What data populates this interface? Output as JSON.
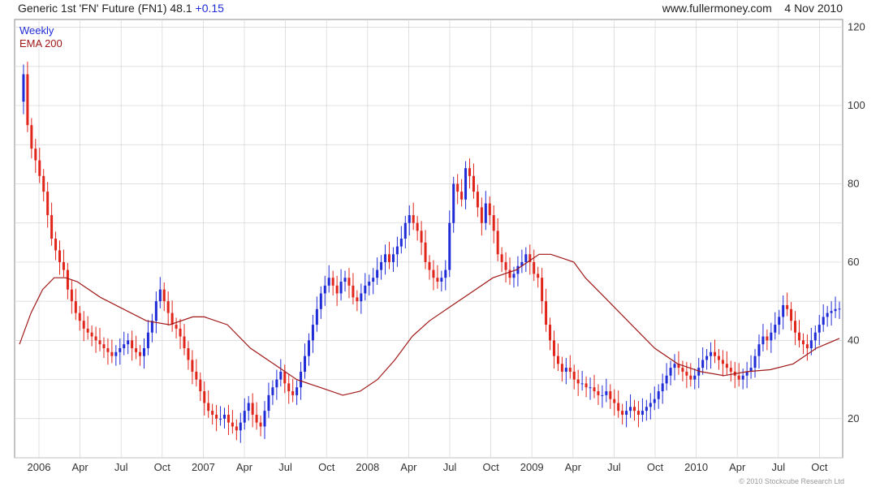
{
  "header": {
    "instrument": "Generic 1st 'FN' Future (FN1)",
    "last": "48.1",
    "change": "+0.15",
    "site": "www.fullermoney.com",
    "date": "4 Nov 2010"
  },
  "legend": {
    "series1": "Weekly",
    "series2": "EMA 200"
  },
  "copyright": "© 2010 Stockcube Research Ltd",
  "colors": {
    "up": "#1f2bd6",
    "down": "#e1251b",
    "ema": "#a01818",
    "grid": "#d4d4d4",
    "axis": "#777777"
  },
  "chart_data": {
    "type": "candlestick",
    "x_ticks": [
      "2006",
      "Apr",
      "Jul",
      "Oct",
      "2007",
      "Apr",
      "Jul",
      "Oct",
      "2008",
      "Apr",
      "Jul",
      "Oct",
      "2009",
      "Apr",
      "Jul",
      "Oct",
      "2010",
      "Apr",
      "Jul",
      "Oct"
    ],
    "y_ticks": [
      20,
      40,
      60,
      80,
      100,
      120
    ],
    "ylim": [
      10,
      122
    ],
    "grid": true,
    "weekly_close_points": [
      [
        0,
        101
      ],
      [
        1,
        108
      ],
      [
        2,
        95
      ],
      [
        3,
        89
      ],
      [
        4,
        86
      ],
      [
        5,
        82
      ],
      [
        6,
        78
      ],
      [
        7,
        72
      ],
      [
        8,
        66
      ],
      [
        9,
        63
      ],
      [
        10,
        60
      ],
      [
        11,
        58
      ],
      [
        12,
        53
      ],
      [
        13,
        50
      ],
      [
        14,
        47
      ],
      [
        15,
        45
      ],
      [
        16,
        43
      ],
      [
        17,
        42
      ],
      [
        18,
        41
      ],
      [
        19,
        40
      ],
      [
        20,
        39
      ],
      [
        21,
        38
      ],
      [
        22,
        37
      ],
      [
        23,
        36
      ],
      [
        24,
        37
      ],
      [
        25,
        38
      ],
      [
        26,
        39
      ],
      [
        27,
        40
      ],
      [
        28,
        38
      ],
      [
        29,
        37
      ],
      [
        30,
        36
      ],
      [
        31,
        38
      ],
      [
        32,
        42
      ],
      [
        33,
        45
      ],
      [
        34,
        50
      ],
      [
        35,
        53
      ],
      [
        36,
        50
      ],
      [
        37,
        47
      ],
      [
        38,
        44
      ],
      [
        39,
        43
      ],
      [
        40,
        41
      ],
      [
        41,
        38
      ],
      [
        42,
        35
      ],
      [
        43,
        32
      ],
      [
        44,
        30
      ],
      [
        45,
        27
      ],
      [
        46,
        24
      ],
      [
        47,
        22
      ],
      [
        48,
        21
      ],
      [
        49,
        20
      ],
      [
        50,
        20
      ],
      [
        51,
        21
      ],
      [
        52,
        19
      ],
      [
        53,
        18
      ],
      [
        54,
        17
      ],
      [
        55,
        19
      ],
      [
        56,
        22
      ],
      [
        57,
        24
      ],
      [
        58,
        21
      ],
      [
        59,
        19
      ],
      [
        60,
        18
      ],
      [
        61,
        22
      ],
      [
        62,
        26
      ],
      [
        63,
        28
      ],
      [
        64,
        30
      ],
      [
        65,
        32
      ],
      [
        66,
        29
      ],
      [
        67,
        27
      ],
      [
        68,
        26
      ],
      [
        69,
        28
      ],
      [
        70,
        32
      ],
      [
        71,
        36
      ],
      [
        72,
        40
      ],
      [
        73,
        44
      ],
      [
        74,
        48
      ],
      [
        75,
        52
      ],
      [
        76,
        54
      ],
      [
        77,
        56
      ],
      [
        78,
        54
      ],
      [
        79,
        52
      ],
      [
        80,
        55
      ],
      [
        81,
        56
      ],
      [
        82,
        54
      ],
      [
        83,
        51
      ],
      [
        84,
        50
      ],
      [
        85,
        52
      ],
      [
        86,
        54
      ],
      [
        87,
        55
      ],
      [
        88,
        56
      ],
      [
        89,
        58
      ],
      [
        90,
        60
      ],
      [
        91,
        62
      ],
      [
        92,
        60
      ],
      [
        93,
        62
      ],
      [
        94,
        64
      ],
      [
        95,
        66
      ],
      [
        96,
        70
      ],
      [
        97,
        72
      ],
      [
        98,
        70
      ],
      [
        99,
        68
      ],
      [
        100,
        65
      ],
      [
        101,
        60
      ],
      [
        102,
        58
      ],
      [
        103,
        56
      ],
      [
        104,
        55
      ],
      [
        105,
        56
      ],
      [
        106,
        58
      ],
      [
        107,
        70
      ],
      [
        108,
        80
      ],
      [
        109,
        78
      ],
      [
        110,
        76
      ],
      [
        111,
        84
      ],
      [
        112,
        82
      ],
      [
        113,
        78
      ],
      [
        114,
        74
      ],
      [
        115,
        70
      ],
      [
        116,
        75
      ],
      [
        117,
        72
      ],
      [
        118,
        68
      ],
      [
        119,
        62
      ],
      [
        120,
        60
      ],
      [
        121,
        58
      ],
      [
        122,
        56
      ],
      [
        123,
        57
      ],
      [
        124,
        59
      ],
      [
        125,
        60
      ],
      [
        126,
        62
      ],
      [
        127,
        60
      ],
      [
        128,
        57
      ],
      [
        129,
        56
      ],
      [
        130,
        50
      ],
      [
        131,
        44
      ],
      [
        132,
        40
      ],
      [
        133,
        36
      ],
      [
        134,
        34
      ],
      [
        135,
        32
      ],
      [
        136,
        33
      ],
      [
        137,
        32
      ],
      [
        138,
        30
      ],
      [
        139,
        29
      ],
      [
        140,
        29
      ],
      [
        141,
        28
      ],
      [
        142,
        28
      ],
      [
        143,
        27
      ],
      [
        144,
        26
      ],
      [
        145,
        26
      ],
      [
        146,
        27
      ],
      [
        147,
        25
      ],
      [
        148,
        24
      ],
      [
        149,
        22
      ],
      [
        150,
        21
      ],
      [
        151,
        22
      ],
      [
        152,
        23
      ],
      [
        153,
        22
      ],
      [
        154,
        21
      ],
      [
        155,
        22
      ],
      [
        156,
        23
      ],
      [
        157,
        24
      ],
      [
        158,
        25
      ],
      [
        159,
        27
      ],
      [
        160,
        29
      ],
      [
        161,
        31
      ],
      [
        162,
        33
      ],
      [
        163,
        34
      ],
      [
        164,
        33
      ],
      [
        165,
        32
      ],
      [
        166,
        31
      ],
      [
        167,
        30
      ],
      [
        168,
        31
      ],
      [
        169,
        33
      ],
      [
        170,
        35
      ],
      [
        171,
        36
      ],
      [
        172,
        37
      ],
      [
        173,
        36
      ],
      [
        174,
        35
      ],
      [
        175,
        34
      ],
      [
        176,
        33
      ],
      [
        177,
        32
      ],
      [
        178,
        31
      ],
      [
        179,
        30
      ],
      [
        180,
        31
      ],
      [
        181,
        32
      ],
      [
        182,
        33
      ],
      [
        183,
        36
      ],
      [
        184,
        39
      ],
      [
        185,
        41
      ],
      [
        186,
        40
      ],
      [
        187,
        42
      ],
      [
        188,
        44
      ],
      [
        189,
        46
      ],
      [
        190,
        49
      ],
      [
        191,
        48
      ],
      [
        192,
        45
      ],
      [
        193,
        42
      ],
      [
        194,
        40
      ],
      [
        195,
        39
      ],
      [
        196,
        38
      ],
      [
        197,
        40
      ],
      [
        198,
        42
      ],
      [
        199,
        44
      ],
      [
        200,
        46
      ],
      [
        201,
        47
      ],
      [
        202,
        47.5
      ],
      [
        203,
        48
      ],
      [
        204,
        48.1
      ]
    ],
    "ema_points": [
      [
        0,
        39
      ],
      [
        4,
        47
      ],
      [
        8,
        53
      ],
      [
        12,
        56
      ],
      [
        16,
        56
      ],
      [
        20,
        55
      ],
      [
        28,
        51
      ],
      [
        36,
        48
      ],
      [
        44,
        45
      ],
      [
        52,
        44
      ],
      [
        60,
        46
      ],
      [
        64,
        46
      ],
      [
        72,
        44
      ],
      [
        80,
        38
      ],
      [
        88,
        34
      ],
      [
        96,
        30
      ],
      [
        104,
        28
      ],
      [
        112,
        26
      ],
      [
        118,
        27
      ],
      [
        124,
        30
      ],
      [
        130,
        35
      ],
      [
        136,
        41
      ],
      [
        142,
        45
      ],
      [
        148,
        48
      ],
      [
        156,
        52
      ],
      [
        164,
        56
      ],
      [
        172,
        58
      ],
      [
        176,
        60
      ],
      [
        180,
        62
      ],
      [
        184,
        62
      ],
      [
        188,
        61
      ],
      [
        192,
        60
      ],
      [
        196,
        56
      ],
      [
        204,
        50
      ],
      [
        212,
        44
      ],
      [
        220,
        38
      ],
      [
        228,
        34
      ],
      [
        236,
        32
      ],
      [
        244,
        31
      ],
      [
        252,
        32
      ],
      [
        260,
        32.5
      ],
      [
        268,
        34
      ],
      [
        276,
        38
      ],
      [
        284,
        40.5
      ]
    ]
  }
}
